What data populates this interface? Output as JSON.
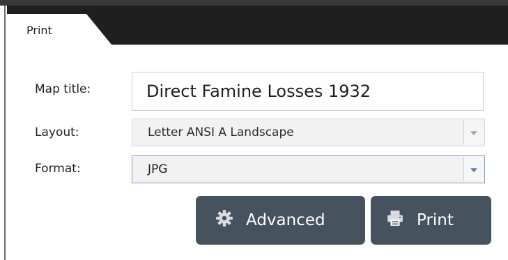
{
  "tab": {
    "label": "Print"
  },
  "form": {
    "map_title_label": "Map title:",
    "map_title_value": "Direct Famine Losses 1932",
    "layout_label": "Layout:",
    "layout_value": "Letter ANSI A Landscape",
    "format_label": "Format:",
    "format_value": "JPG"
  },
  "buttons": {
    "advanced_label": "Advanced",
    "print_label": "Print"
  },
  "icons": {
    "advanced": "gear-icon",
    "print": "printer-icon",
    "dropdown": "chevron-down-icon"
  },
  "colors": {
    "button_bg": "#47525f",
    "tab_strip": "#1f1f1f",
    "top_bar": "#3b363c",
    "format_border": "#7fa0c8"
  }
}
